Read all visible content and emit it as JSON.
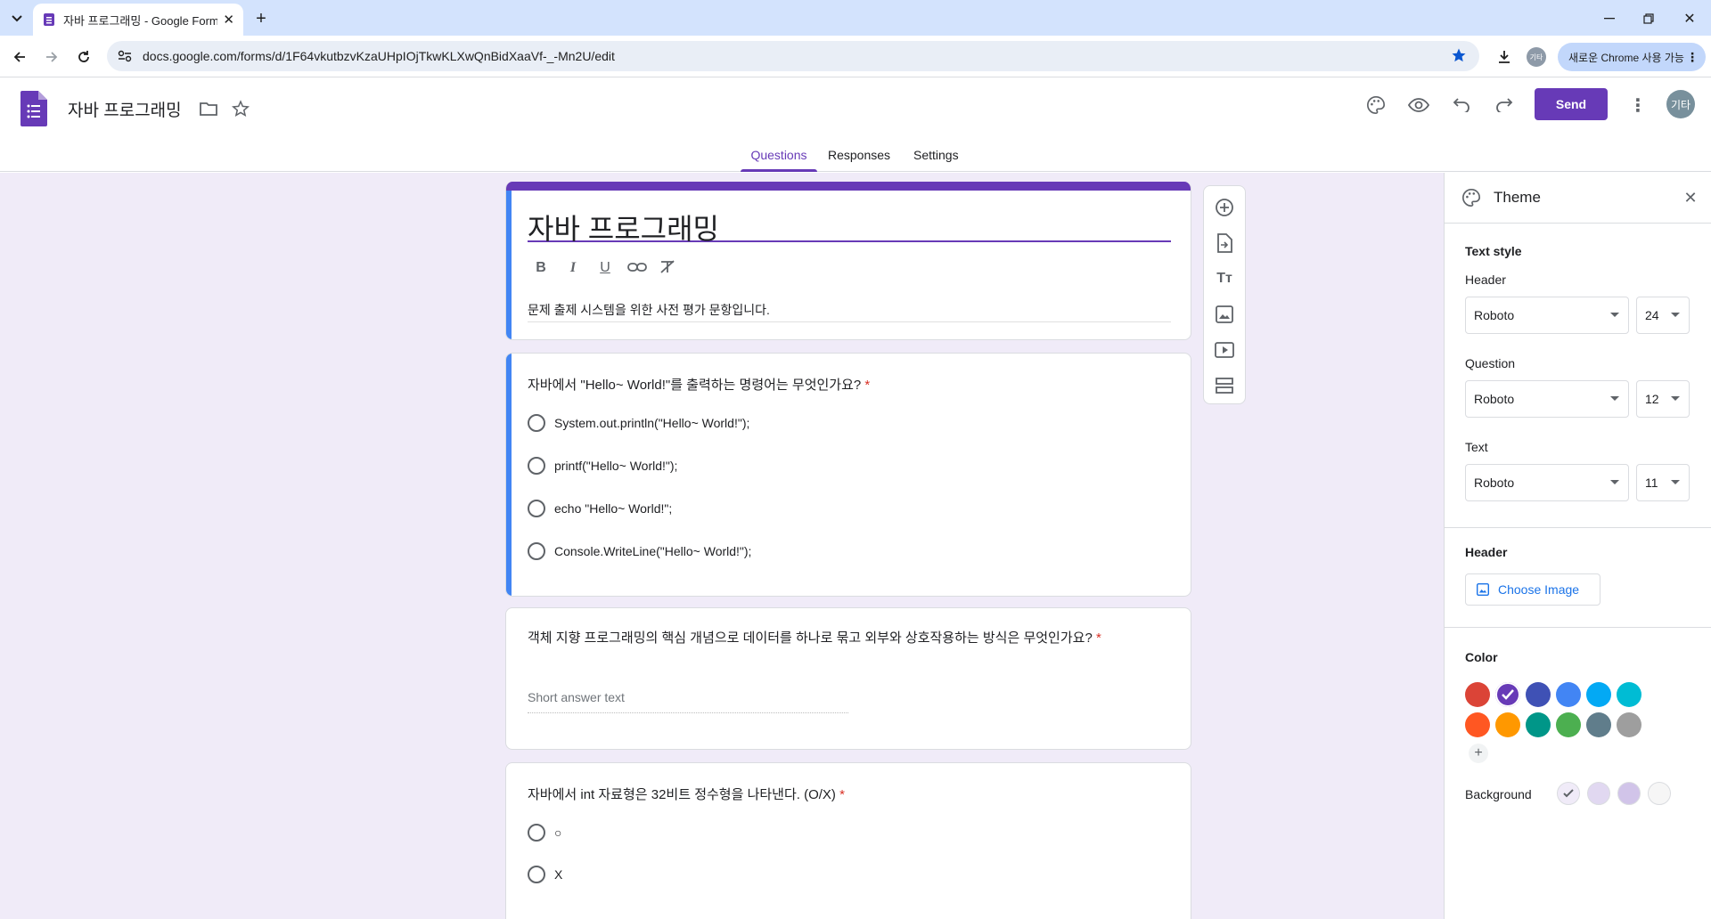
{
  "browser": {
    "tab_title": "자바 프로그래밍 - Google Forms",
    "url": "docs.google.com/forms/d/1F64vkutbzvKzaUHpIOjTkwKLXwQnBidXaaVf-_-Mn2U/edit",
    "avatar_label": "기타",
    "chrome_chip": "새로운 Chrome 사용 가능"
  },
  "form_header": {
    "title": "자바 프로그래밍",
    "send_label": "Send",
    "avatar_label": "기타",
    "tabs": [
      "Questions",
      "Responses",
      "Settings"
    ],
    "active_tab": "Questions"
  },
  "form": {
    "title": "자바 프로그래밍",
    "description": "문제 출제 시스템을 위한 사전 평가 문항입니다.",
    "questions": [
      {
        "text": "자바에서 \"Hello~ World!\"를 출력하는 명령어는 무엇인가요?",
        "required": "*",
        "type": "multiple_choice",
        "options": [
          "System.out.println(\"Hello~ World!\");",
          "printf(\"Hello~ World!\");",
          "echo \"Hello~ World!\";",
          "Console.WriteLine(\"Hello~ World!\");"
        ]
      },
      {
        "text": "객체 지향 프로그래밍의 핵심 개념으로 데이터를 하나로 묶고 외부와 상호작용하는 방식은 무엇인가요?",
        "required": "*",
        "type": "short_answer",
        "placeholder": "Short answer text"
      },
      {
        "text": "자바에서 int 자료형은 32비트 정수형을 나타낸다. (O/X)",
        "required": "*",
        "type": "multiple_choice",
        "options": [
          "○",
          "X"
        ]
      }
    ]
  },
  "theme_panel": {
    "title": "Theme",
    "text_style_label": "Text style",
    "header_label": "Header",
    "header_font": "Roboto",
    "header_size": "24",
    "question_label": "Question",
    "question_font": "Roboto",
    "question_size": "12",
    "text_label": "Text",
    "text_font": "Roboto",
    "text_size": "11",
    "header_section_label": "Header",
    "choose_image_label": "Choose Image",
    "color_label": "Color",
    "colors": [
      "#db4437",
      "#673ab7",
      "#3f51b5",
      "#4285f4",
      "#03a9f4",
      "#00bcd4",
      "#ff5722",
      "#ff9800",
      "#009688",
      "#4caf50",
      "#607d8b",
      "#9e9e9e"
    ],
    "selected_color": "#673ab7",
    "background_label": "Background",
    "background_colors": [
      "#f0ebf8",
      "#e1d8f1",
      "#d1c4e9",
      "#f6f6f6"
    ],
    "selected_background": "#f0ebf8"
  }
}
